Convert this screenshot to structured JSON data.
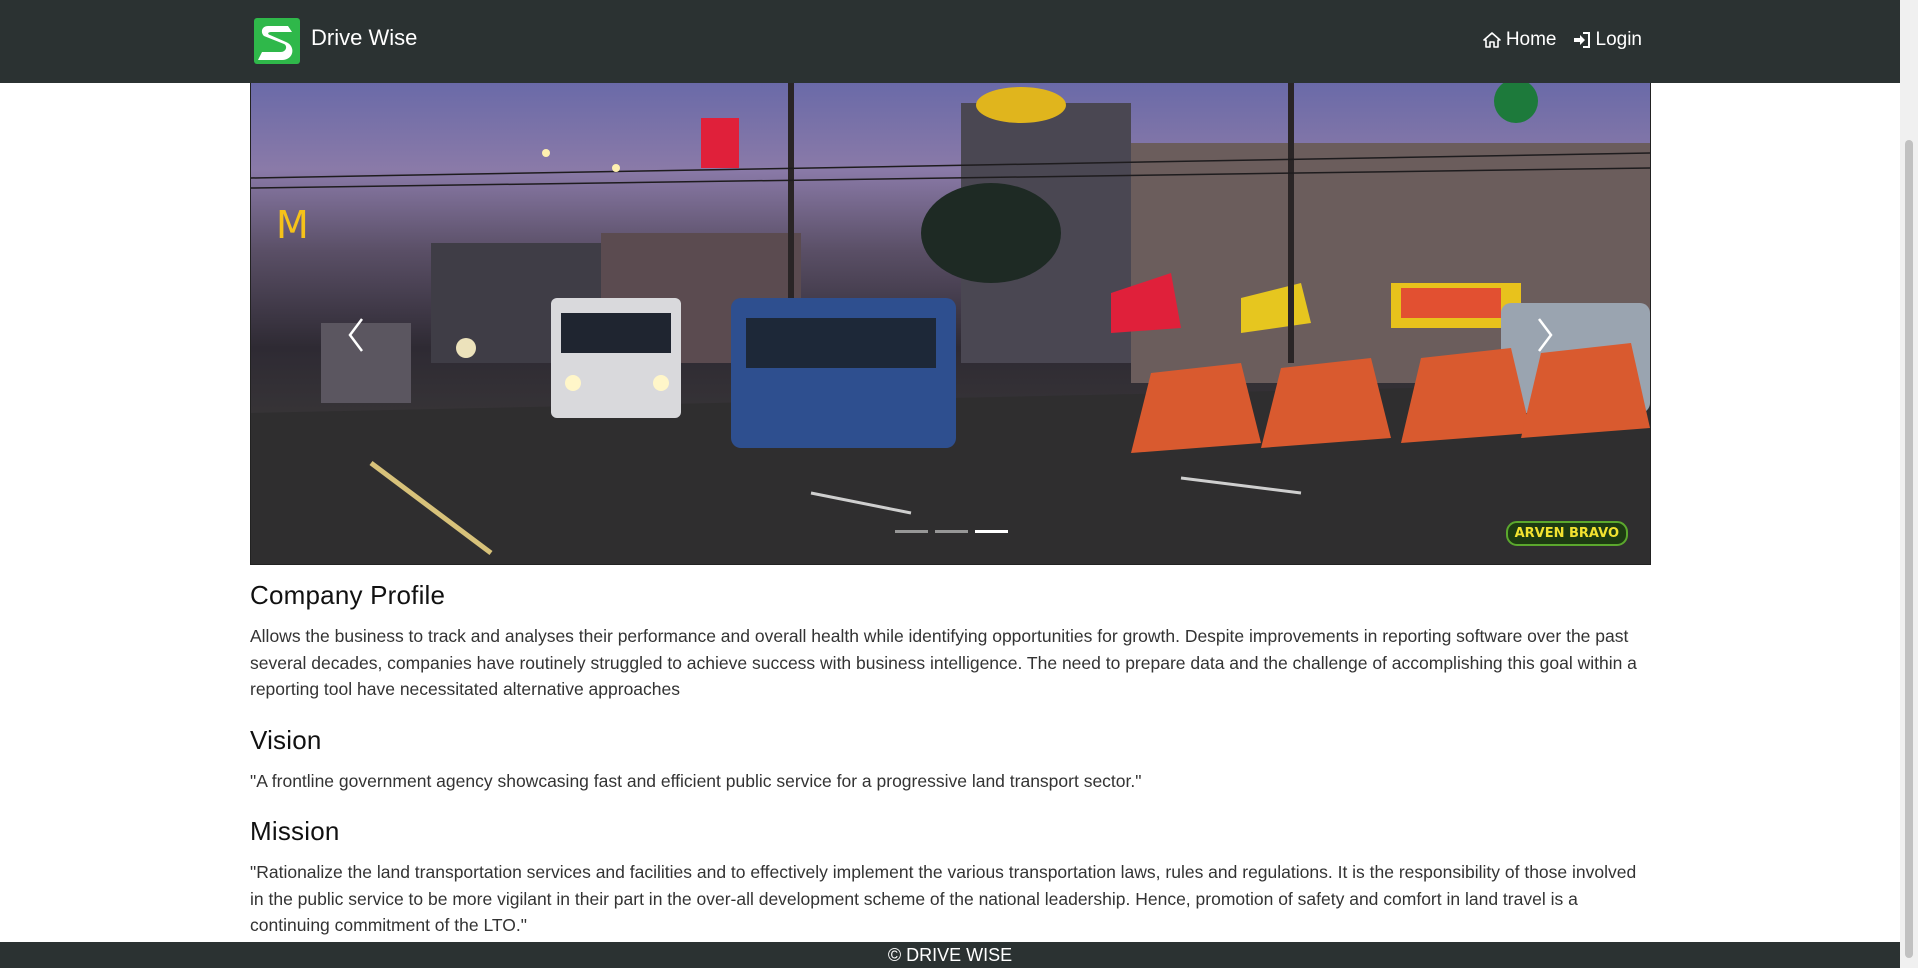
{
  "brand": {
    "name": "Drive Wise",
    "logo_icon": "drive-wise-logo-icon",
    "accent": "#2fb84a"
  },
  "nav": [
    {
      "label": "Home",
      "icon": "home-icon"
    },
    {
      "label": "Login",
      "icon": "login-icon"
    }
  ],
  "carousel": {
    "slides_count": 3,
    "active_index": 2,
    "prev_icon": "chevron-left-icon",
    "next_icon": "chevron-right-icon",
    "watermark": "ARVEN BRAVO"
  },
  "sections": {
    "profile": {
      "title": "Company Profile",
      "body": "Allows the business to track and analyses their performance and overall health while identifying opportunities for growth. Despite improvements in reporting software over the past several decades, companies have routinely struggled to achieve success with business intelligence. The need to prepare data and the challenge of accomplishing this goal within a reporting tool have necessitated alternative approaches"
    },
    "vision": {
      "title": "Vision",
      "body": "\"A frontline government agency showcasing fast and efficient public service for a progressive land transport sector.\""
    },
    "mission": {
      "title": "Mission",
      "body": "\"Rationalize the land transportation services and facilities and to effectively implement the various transportation laws, rules and regulations. It is the responsibility of those involved in the public service to be more vigilant in their part in the over-all development scheme of the national leadership. Hence, promotion of safety and comfort in land travel is a continuing commitment of the LTO.\""
    }
  },
  "footer": {
    "text": "© DRIVE WISE"
  },
  "colors": {
    "navbar_bg": "#2b3232",
    "footer_bg": "#2b3232",
    "text": "#333333"
  }
}
